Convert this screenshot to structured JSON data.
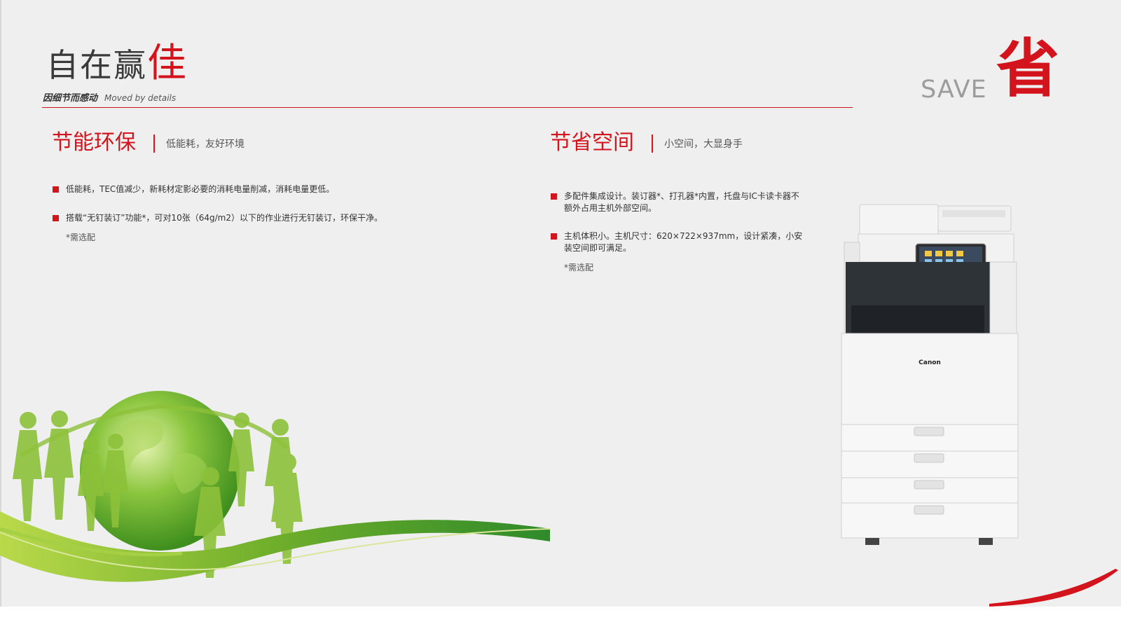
{
  "header": {
    "title_main": "自在赢",
    "title_accent": "佳",
    "subtitle_cn": "因细节而感动",
    "subtitle_en": "Moved by details"
  },
  "badge": {
    "save_text": "SAVE",
    "char": "省"
  },
  "sections": [
    {
      "title": "节能环保",
      "subtitle": "低能耗，友好环境",
      "bullets": [
        "低能耗，TEC值减少，新耗材定影必要的消耗电量削减，消耗电量更低。",
        "搭载“无钉装订”功能*，可对10张（64g/m2）以下的作业进行无钉装订，环保干净。"
      ],
      "note": "*需选配"
    },
    {
      "title": "节省空间",
      "subtitle": "小空间，大显身手",
      "bullets": [
        "多配件集成设计。装订器*、打孔器*内置，托盘与IC卡读卡器不额外占用主机外部空间。",
        "主机体积小。主机尺寸：620×722×937mm，设计紧凑，小安装空间即可满足。"
      ],
      "note": "*需选配"
    }
  ],
  "printer": {
    "brand": "Canon"
  },
  "colors": {
    "accent": "#d4141c",
    "background": "#efefef",
    "green": "#7cb82f"
  }
}
